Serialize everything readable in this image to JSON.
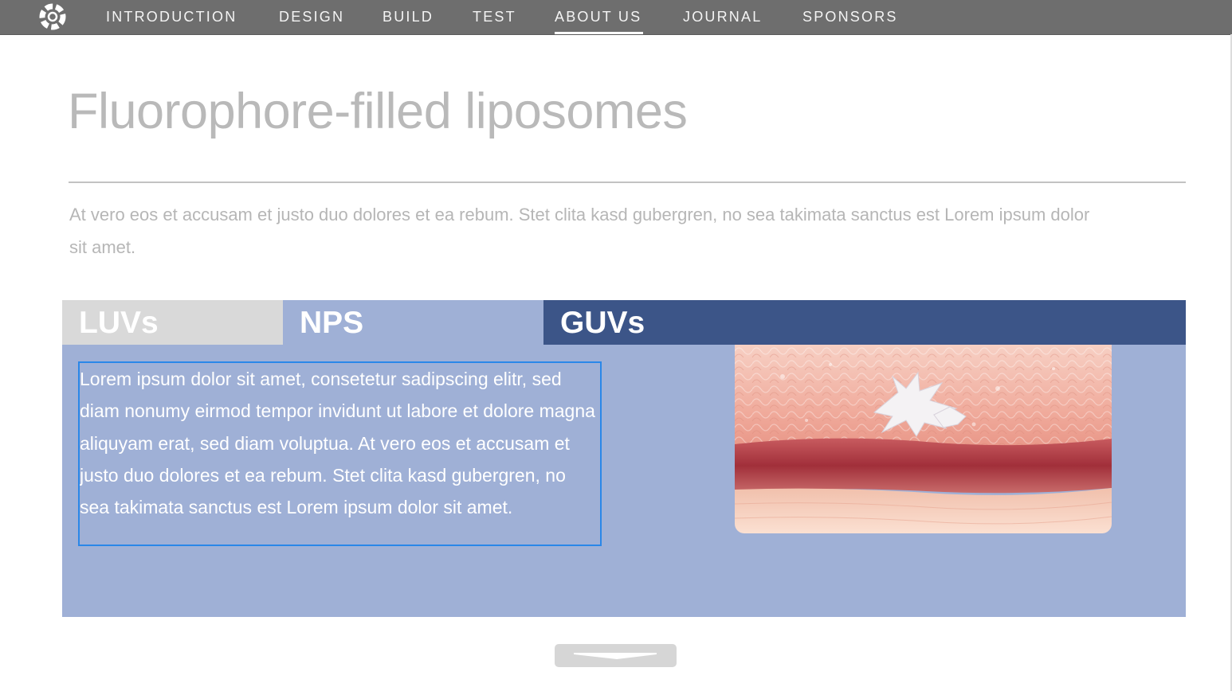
{
  "nav": {
    "items": [
      {
        "label": "INTRODUCTION",
        "active": false
      },
      {
        "label": "DESIGN",
        "active": false
      },
      {
        "label": "BUILD",
        "active": false
      },
      {
        "label": "TEST",
        "active": false
      },
      {
        "label": "ABOUT US",
        "active": true
      },
      {
        "label": "JOURNAL",
        "active": false
      },
      {
        "label": "SPONSORS",
        "active": false
      }
    ]
  },
  "page": {
    "title": "Fluorophore-filled liposomes",
    "intro": "At vero eos et accusam et justo duo dolores et ea rebum. Stet clita kasd gubergren, no sea takimata sanctus est Lorem ipsum dolor sit amet."
  },
  "tabs": [
    {
      "label": "LUVs"
    },
    {
      "label": "NPS"
    },
    {
      "label": "GUVs"
    }
  ],
  "panel": {
    "text": "Lorem ipsum dolor sit amet, consetetur sadipscing elitr, sed diam nonumy eirmod tempor invidunt ut labore et dolore magna aliquyam erat, sed diam voluptua. At vero eos et accusam et justo duo dolores et ea rebum. Stet clita kasd gubergren, no sea takimata sanctus est Lorem ipsum dolor sit amet."
  },
  "colors": {
    "nav_bg": "#6e6e6e",
    "tab_luvs": "#d9d9d9",
    "tab_nps": "#9fb0d6",
    "tab_guvs": "#3c5588",
    "panel_bg": "#9fb0d6",
    "selection_outline": "#2a87e8"
  },
  "icons": {
    "logo": "swirl-logo-icon",
    "scroll": "chevron-down-icon"
  }
}
